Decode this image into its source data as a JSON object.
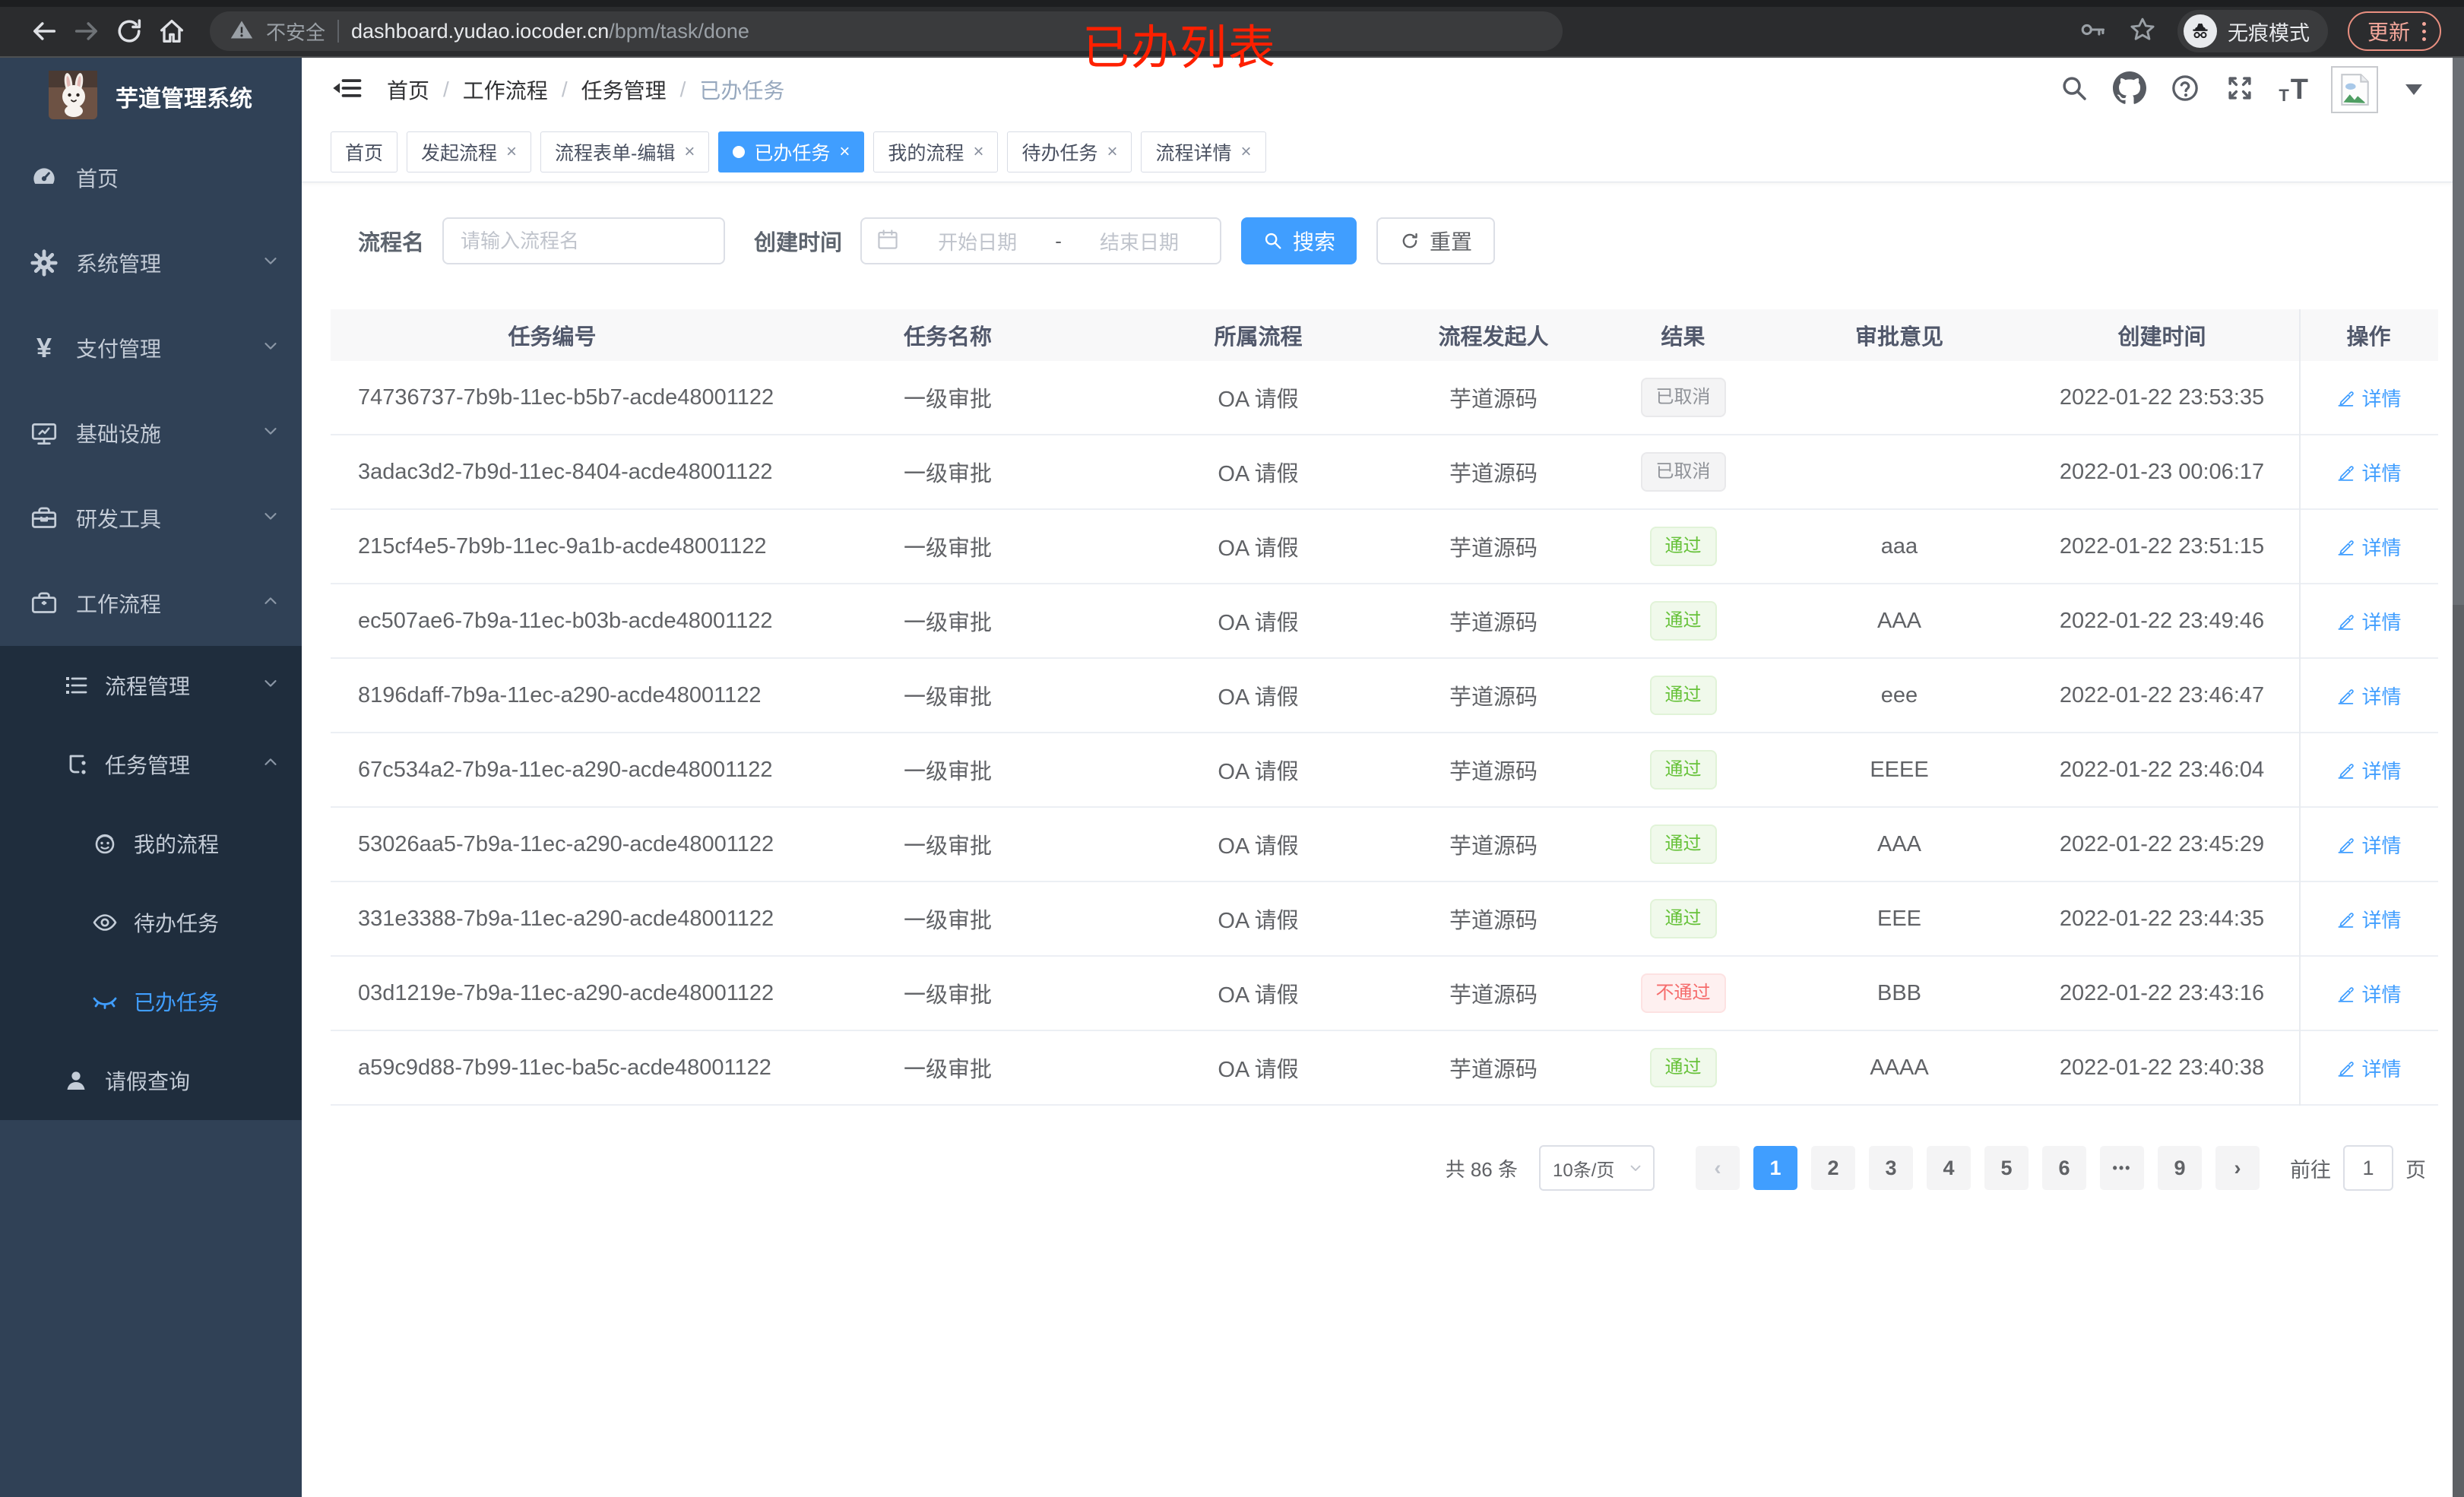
{
  "browser": {
    "security_label": "不安全",
    "url_domain": "dashboard.yudao.iocoder.cn",
    "url_path": "/bpm/task/done",
    "incognito_label": "无痕模式",
    "update_label": "更新"
  },
  "annotation": "已办列表",
  "sidebar": {
    "title": "芋道管理系统",
    "menu_home": "首页",
    "menu_system": "系统管理",
    "menu_pay": "支付管理",
    "menu_infra": "基础设施",
    "menu_dev": "研发工具",
    "menu_workflow": "工作流程",
    "sub_process_mgmt": "流程管理",
    "sub_task_mgmt": "任务管理",
    "child_my_process": "我的流程",
    "child_todo": "待办任务",
    "child_done": "已办任务",
    "item_leave": "请假查询"
  },
  "breadcrumb": {
    "separator": "/",
    "items": [
      "首页",
      "工作流程",
      "任务管理",
      "已办任务"
    ]
  },
  "tabs": {
    "close_glyph": "×",
    "items": [
      {
        "label": "首页"
      },
      {
        "label": "发起流程"
      },
      {
        "label": "流程表单-编辑"
      },
      {
        "label": "已办任务"
      },
      {
        "label": "我的流程"
      },
      {
        "label": "待办任务"
      },
      {
        "label": "流程详情"
      }
    ]
  },
  "filters": {
    "name_label": "流程名",
    "name_placeholder": "请输入流程名",
    "time_label": "创建时间",
    "start_placeholder": "开始日期",
    "range_separator": "-",
    "end_placeholder": "结束日期",
    "search_label": "搜索",
    "reset_label": "重置"
  },
  "table": {
    "columns": [
      "任务编号",
      "任务名称",
      "所属流程",
      "流程发起人",
      "结果",
      "审批意见",
      "创建时间",
      "操作"
    ],
    "action_label": "详情",
    "rows": [
      {
        "id": "74736737-7b9b-11ec-b5b7-acde48001122",
        "name": "一级审批",
        "process": "OA 请假",
        "starter": "芋道源码",
        "result": "已取消",
        "result_type": "info",
        "comment": "",
        "created": "2022-01-22 23:53:35"
      },
      {
        "id": "3adac3d2-7b9d-11ec-8404-acde48001122",
        "name": "一级审批",
        "process": "OA 请假",
        "starter": "芋道源码",
        "result": "已取消",
        "result_type": "info",
        "comment": "",
        "created": "2022-01-23 00:06:17"
      },
      {
        "id": "215cf4e5-7b9b-11ec-9a1b-acde48001122",
        "name": "一级审批",
        "process": "OA 请假",
        "starter": "芋道源码",
        "result": "通过",
        "result_type": "success",
        "comment": "aaa",
        "created": "2022-01-22 23:51:15"
      },
      {
        "id": "ec507ae6-7b9a-11ec-b03b-acde48001122",
        "name": "一级审批",
        "process": "OA 请假",
        "starter": "芋道源码",
        "result": "通过",
        "result_type": "success",
        "comment": "AAA",
        "created": "2022-01-22 23:49:46"
      },
      {
        "id": "8196daff-7b9a-11ec-a290-acde48001122",
        "name": "一级审批",
        "process": "OA 请假",
        "starter": "芋道源码",
        "result": "通过",
        "result_type": "success",
        "comment": "eee",
        "created": "2022-01-22 23:46:47"
      },
      {
        "id": "67c534a2-7b9a-11ec-a290-acde48001122",
        "name": "一级审批",
        "process": "OA 请假",
        "starter": "芋道源码",
        "result": "通过",
        "result_type": "success",
        "comment": "EEEE",
        "created": "2022-01-22 23:46:04"
      },
      {
        "id": "53026aa5-7b9a-11ec-a290-acde48001122",
        "name": "一级审批",
        "process": "OA 请假",
        "starter": "芋道源码",
        "result": "通过",
        "result_type": "success",
        "comment": "AAA",
        "created": "2022-01-22 23:45:29"
      },
      {
        "id": "331e3388-7b9a-11ec-a290-acde48001122",
        "name": "一级审批",
        "process": "OA 请假",
        "starter": "芋道源码",
        "result": "通过",
        "result_type": "success",
        "comment": "EEE",
        "created": "2022-01-22 23:44:35"
      },
      {
        "id": "03d1219e-7b9a-11ec-a290-acde48001122",
        "name": "一级审批",
        "process": "OA 请假",
        "starter": "芋道源码",
        "result": "不通过",
        "result_type": "danger",
        "comment": "BBB",
        "created": "2022-01-22 23:43:16"
      },
      {
        "id": "a59c9d88-7b99-11ec-ba5c-acde48001122",
        "name": "一级审批",
        "process": "OA 请假",
        "starter": "芋道源码",
        "result": "通过",
        "result_type": "success",
        "comment": "AAAA",
        "created": "2022-01-22 23:40:38"
      }
    ]
  },
  "pagination": {
    "total": "共 86 条",
    "page_size": "10条/页",
    "prev_glyph": "‹",
    "next_glyph": "›",
    "ellipsis": "•••",
    "pages": [
      "1",
      "2",
      "3",
      "4",
      "5",
      "6"
    ],
    "last_page": "9",
    "goto_label": "前往",
    "goto_value": "1",
    "unit_label": "页"
  },
  "colors": {
    "primary": "#409eff",
    "success": "#67c23a",
    "danger": "#f56c6c",
    "info": "#909399",
    "sidebar_bg": "#304156",
    "submenu_bg": "#1f2d3d"
  }
}
